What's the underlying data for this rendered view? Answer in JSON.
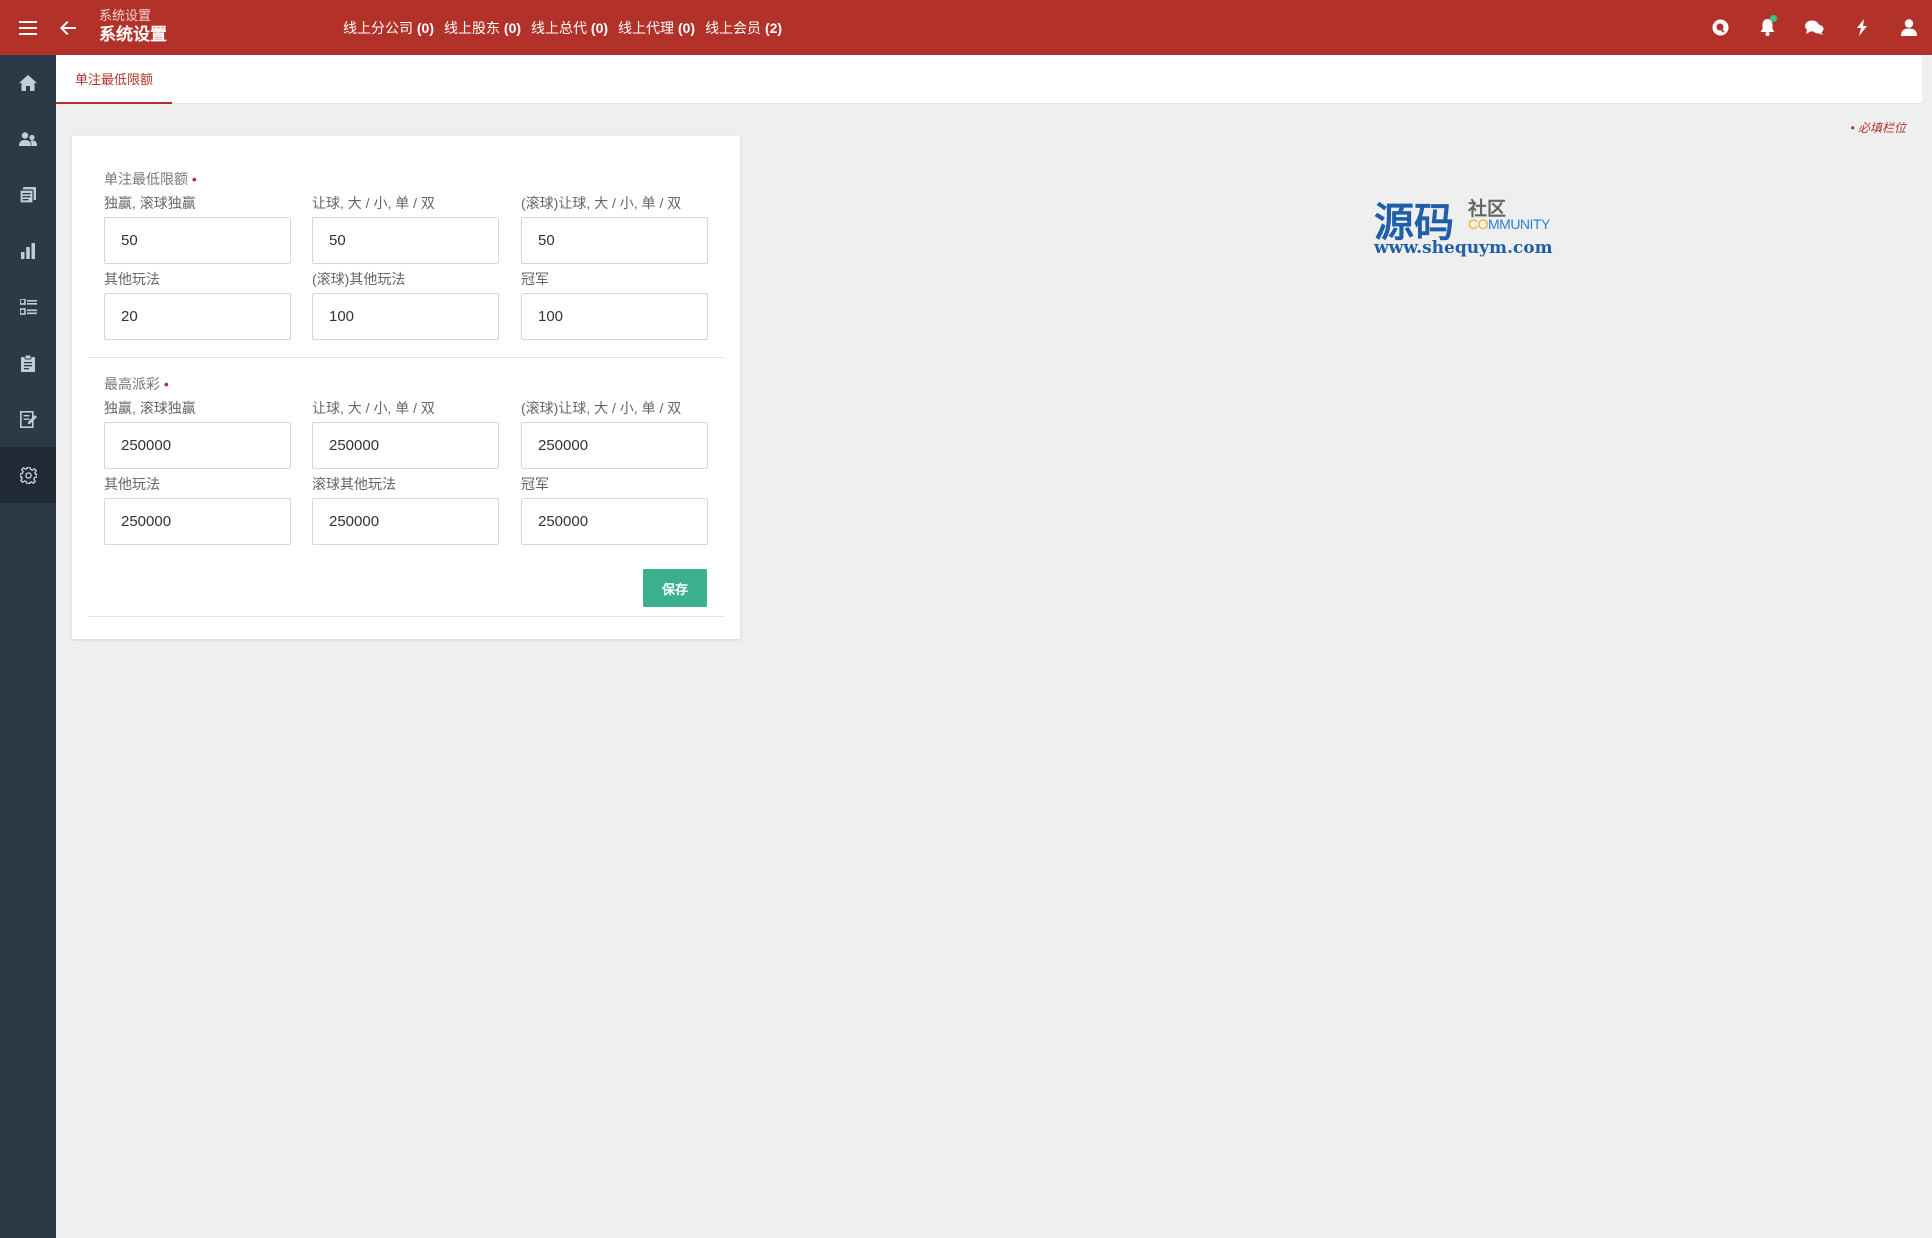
{
  "header": {
    "subtitle": "系统设置",
    "title": "系统设置",
    "online": [
      {
        "label": "线上分公司",
        "count": "(0)"
      },
      {
        "label": "线上股东",
        "count": "(0)"
      },
      {
        "label": "线上总代",
        "count": "(0)"
      },
      {
        "label": "线上代理",
        "count": "(0)"
      },
      {
        "label": "线上会员",
        "count": "(2)"
      }
    ],
    "icons": [
      "search-icon",
      "bell-icon",
      "chat-icon",
      "lightning-icon",
      "user-icon"
    ]
  },
  "sidebar": {
    "items": [
      "home-icon",
      "users-icon",
      "documents-icon",
      "chart-icon",
      "list-icon",
      "clipboard-icon",
      "report-icon",
      "gear-icon"
    ],
    "active_index": 7
  },
  "tabs": [
    {
      "label": "单注最低限额",
      "active": true
    }
  ],
  "required_note": "• 必填栏位",
  "sections": [
    {
      "title": "单注最低限额",
      "fields": [
        {
          "label": "独赢, 滚球独赢",
          "value": "50"
        },
        {
          "label": "让球, 大 / 小, 单 / 双",
          "value": "50"
        },
        {
          "label": "(滚球)让球, 大 / 小, 单 / 双",
          "value": "50"
        },
        {
          "label": "其他玩法",
          "value": "20"
        },
        {
          "label": "(滚球)其他玩法",
          "value": "100"
        },
        {
          "label": "冠军",
          "value": "100"
        }
      ]
    },
    {
      "title": "最高派彩",
      "fields": [
        {
          "label": "独赢, 滚球独赢",
          "value": "250000"
        },
        {
          "label": "让球, 大 / 小, 单 / 双",
          "value": "250000"
        },
        {
          "label": "(滚球)让球, 大 / 小, 单 / 双",
          "value": "250000"
        },
        {
          "label": "其他玩法",
          "value": "250000"
        },
        {
          "label": "滚球其他玩法",
          "value": "250000"
        },
        {
          "label": "冠军",
          "value": "250000"
        }
      ]
    }
  ],
  "save_label": "保存",
  "watermark": {
    "big": "源码",
    "small": "社区",
    "community_a": "CO",
    "community_b": "MMUNITY",
    "url": "www.shequym.com"
  },
  "colors": {
    "primary": "#b2322a",
    "sidebar": "#2c3a47",
    "save": "#3bb08f"
  }
}
